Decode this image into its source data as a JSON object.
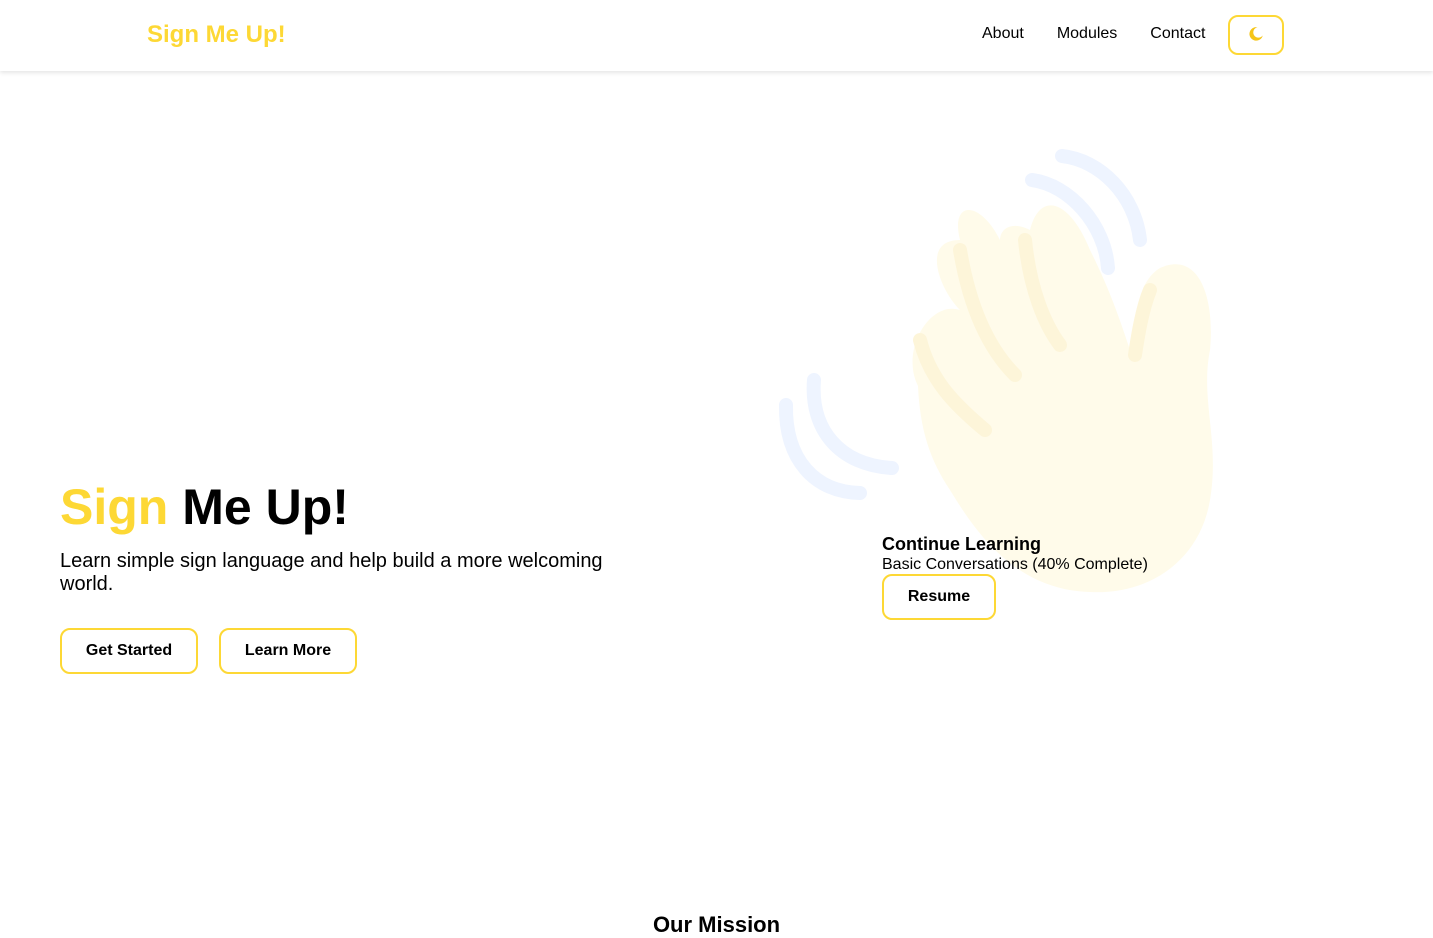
{
  "nav": {
    "brand": "Sign Me Up!",
    "links": [
      "About",
      "Modules",
      "Contact"
    ],
    "theme_toggle_icon": "moon-icon"
  },
  "hero": {
    "title_accent": "Sign",
    "title_rest": "Me Up!",
    "subtitle": "Learn simple sign language and help build a more welcoming world.",
    "buttons": {
      "get_started": "Get Started",
      "learn_more": "Learn More"
    },
    "illustration_icon": "waving-hand-icon"
  },
  "continue_learning": {
    "title": "Continue Learning",
    "course": "Basic Conversations (40% Complete)",
    "progress_percent": 40,
    "button": "Resume"
  },
  "mission": {
    "title": "Our Mission"
  },
  "colors": {
    "accent": "#fdd835",
    "text": "#000000",
    "background": "#ffffff",
    "hand_fill": "#fffbea",
    "wave_lines": "#eef4ff"
  }
}
